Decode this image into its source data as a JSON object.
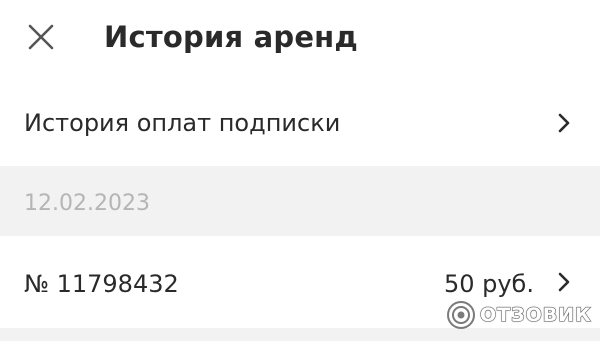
{
  "header": {
    "title": "История аренд",
    "close_icon": "close-icon"
  },
  "menu": {
    "subscription_history_label": "История оплат подписки"
  },
  "rentals": [
    {
      "date": "12.02.2023",
      "order_number": "№ 11798432",
      "amount": "50 руб."
    }
  ],
  "watermark": {
    "text": "ОТЗОВИК"
  },
  "colors": {
    "background": "#ffffff",
    "section_band": "#f2f2f2",
    "text": "#2a2a2a",
    "muted_text": "#b5b5b5"
  }
}
